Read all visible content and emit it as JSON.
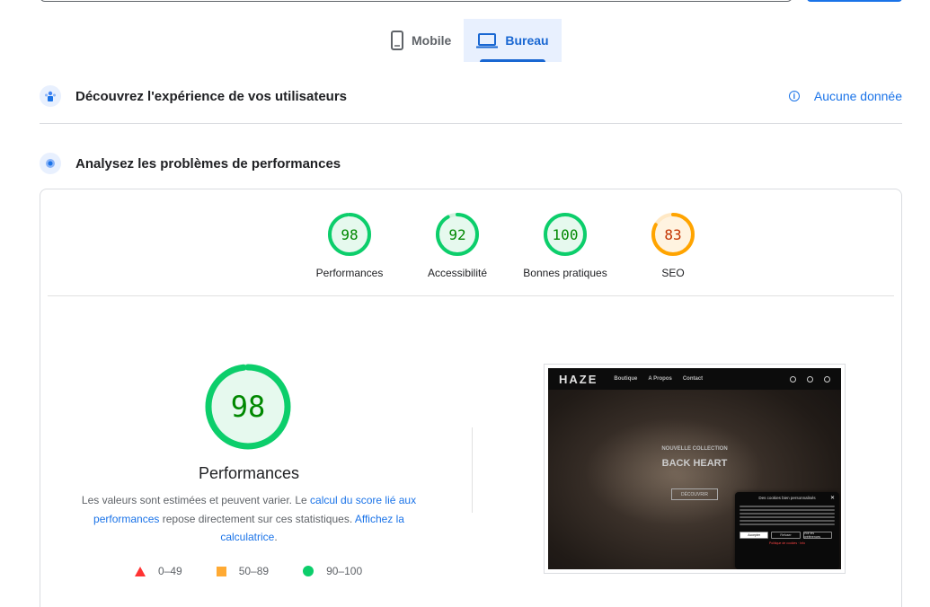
{
  "device_tabs": [
    {
      "label": "Mobile",
      "icon": "smartphone-icon",
      "active": false
    },
    {
      "label": "Bureau",
      "icon": "laptop-icon",
      "active": true
    }
  ],
  "field_section": {
    "title": "Découvrez l'expérience de vos utilisateurs",
    "status": "Aucune donnée"
  },
  "lab_section": {
    "title": "Analysez les problèmes de performances"
  },
  "categories": [
    {
      "label": "Performances",
      "score": "98",
      "rating": "good"
    },
    {
      "label": "Accessibilité",
      "score": "92",
      "rating": "good"
    },
    {
      "label": "Bonnes pratiques",
      "score": "100",
      "rating": "good"
    },
    {
      "label": "SEO",
      "score": "83",
      "rating": "average"
    }
  ],
  "colors": {
    "good": "#0cce6b",
    "average": "#ffa400",
    "poor": "#ff4e42",
    "link": "#1a73e8"
  },
  "main_gauge": {
    "score": "98",
    "title": "Performances",
    "desc_1": "Les valeurs sont estimées et peuvent varier. Le ",
    "link_1": "calcul du score lié aux performances",
    "desc_2": " repose directement sur ces statistiques. ",
    "link_2": "Affichez la calculatrice",
    "desc_3": "."
  },
  "legend": [
    {
      "range": "0–49",
      "shape": "triangle"
    },
    {
      "range": "50–89",
      "shape": "square"
    },
    {
      "range": "90–100",
      "shape": "circle"
    }
  ],
  "screenshot": {
    "logo": "HAZE",
    "nav": [
      "Boutique",
      "A Propos",
      "Contact"
    ],
    "subtitle": "NOUVELLE COLLECTION",
    "hero": "BACK HEART",
    "button": "DÉCOUVRIR",
    "cookie_title": "Des cookies bien personnalisés",
    "cookie_buttons": [
      "Accepter",
      "Refuser",
      "Voir les préférences"
    ],
    "cookie_link": "Politique de cookies · Info"
  }
}
